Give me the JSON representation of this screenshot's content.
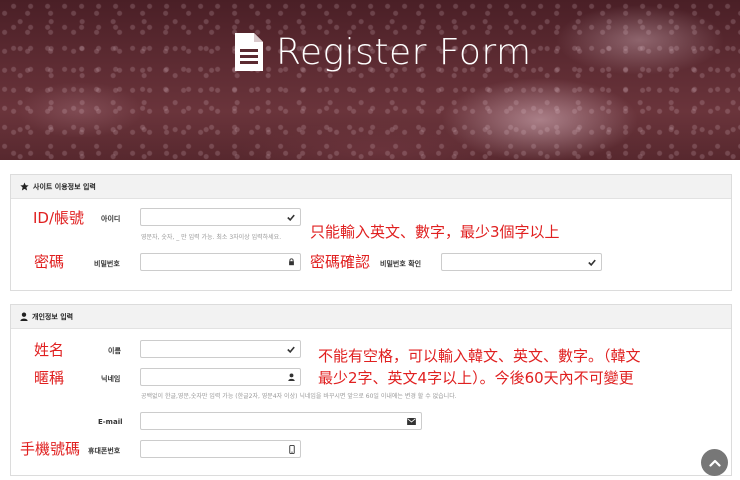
{
  "header": {
    "title": "Register Form"
  },
  "site_section": {
    "heading": "사이트 이용정보 입력",
    "fields": {
      "id_label": "아이디",
      "id_help": "영문자, 숫자, _ 만 입력 가능. 최소 3자이상 입력하세요.",
      "password_label": "비밀번호",
      "password_confirm_label": "비밀번호 확인"
    },
    "annotations": {
      "id": "ID/帳號",
      "id_rule": "只能輸入英文、數字，最少3個字以上",
      "password": "密碼",
      "password_confirm": "密碼確認"
    }
  },
  "personal_section": {
    "heading": "개인정보 입력",
    "fields": {
      "name_label": "이름",
      "nickname_label": "닉네임",
      "nickname_help": "공백없이 한글,영문,숫자만 입력 가능 (한글2자, 영문4자 이상) 닉네임을 바꾸시면 앞으로 60일 이내에는 변경 할 수 없습니다.",
      "email_label": "E-mail",
      "phone_label": "휴대폰번호"
    },
    "annotations": {
      "name": "姓名",
      "nickname": "暱稱",
      "nickname_rule_line1": "不能有空格，可以輸入韓文、英文、數字。（韓文",
      "nickname_rule_line2": "最少2字、英文4字以上）。今後60天內不可變更",
      "phone": "手機號碼"
    }
  },
  "colors": {
    "annotation": "#e02020",
    "hero": "#5b2a31"
  },
  "icons": {
    "title": "document-icon",
    "check": "check-icon",
    "lock": "lock-icon",
    "user": "user-icon",
    "email": "envelope-icon",
    "phone": "mobile-icon",
    "scroll": "chevron-up-icon"
  }
}
